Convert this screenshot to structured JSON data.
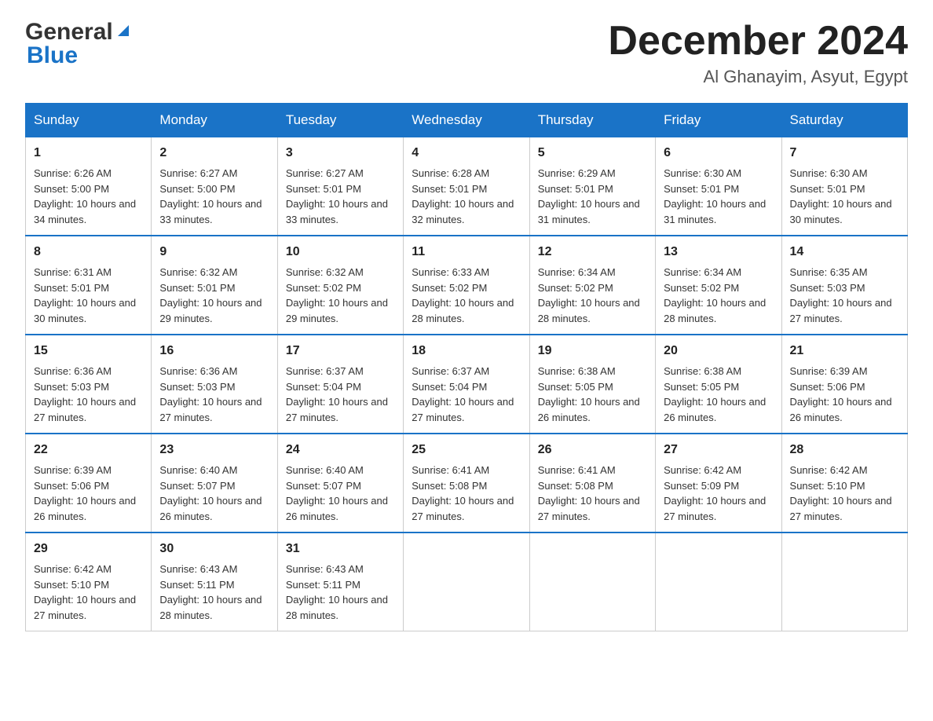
{
  "header": {
    "logo_general": "General",
    "logo_blue": "Blue",
    "month_title": "December 2024",
    "subtitle": "Al Ghanayim, Asyut, Egypt"
  },
  "days_of_week": [
    "Sunday",
    "Monday",
    "Tuesday",
    "Wednesday",
    "Thursday",
    "Friday",
    "Saturday"
  ],
  "weeks": [
    [
      {
        "day": "1",
        "sunrise": "6:26 AM",
        "sunset": "5:00 PM",
        "daylight": "10 hours and 34 minutes."
      },
      {
        "day": "2",
        "sunrise": "6:27 AM",
        "sunset": "5:00 PM",
        "daylight": "10 hours and 33 minutes."
      },
      {
        "day": "3",
        "sunrise": "6:27 AM",
        "sunset": "5:01 PM",
        "daylight": "10 hours and 33 minutes."
      },
      {
        "day": "4",
        "sunrise": "6:28 AM",
        "sunset": "5:01 PM",
        "daylight": "10 hours and 32 minutes."
      },
      {
        "day": "5",
        "sunrise": "6:29 AM",
        "sunset": "5:01 PM",
        "daylight": "10 hours and 31 minutes."
      },
      {
        "day": "6",
        "sunrise": "6:30 AM",
        "sunset": "5:01 PM",
        "daylight": "10 hours and 31 minutes."
      },
      {
        "day": "7",
        "sunrise": "6:30 AM",
        "sunset": "5:01 PM",
        "daylight": "10 hours and 30 minutes."
      }
    ],
    [
      {
        "day": "8",
        "sunrise": "6:31 AM",
        "sunset": "5:01 PM",
        "daylight": "10 hours and 30 minutes."
      },
      {
        "day": "9",
        "sunrise": "6:32 AM",
        "sunset": "5:01 PM",
        "daylight": "10 hours and 29 minutes."
      },
      {
        "day": "10",
        "sunrise": "6:32 AM",
        "sunset": "5:02 PM",
        "daylight": "10 hours and 29 minutes."
      },
      {
        "day": "11",
        "sunrise": "6:33 AM",
        "sunset": "5:02 PM",
        "daylight": "10 hours and 28 minutes."
      },
      {
        "day": "12",
        "sunrise": "6:34 AM",
        "sunset": "5:02 PM",
        "daylight": "10 hours and 28 minutes."
      },
      {
        "day": "13",
        "sunrise": "6:34 AM",
        "sunset": "5:02 PM",
        "daylight": "10 hours and 28 minutes."
      },
      {
        "day": "14",
        "sunrise": "6:35 AM",
        "sunset": "5:03 PM",
        "daylight": "10 hours and 27 minutes."
      }
    ],
    [
      {
        "day": "15",
        "sunrise": "6:36 AM",
        "sunset": "5:03 PM",
        "daylight": "10 hours and 27 minutes."
      },
      {
        "day": "16",
        "sunrise": "6:36 AM",
        "sunset": "5:03 PM",
        "daylight": "10 hours and 27 minutes."
      },
      {
        "day": "17",
        "sunrise": "6:37 AM",
        "sunset": "5:04 PM",
        "daylight": "10 hours and 27 minutes."
      },
      {
        "day": "18",
        "sunrise": "6:37 AM",
        "sunset": "5:04 PM",
        "daylight": "10 hours and 27 minutes."
      },
      {
        "day": "19",
        "sunrise": "6:38 AM",
        "sunset": "5:05 PM",
        "daylight": "10 hours and 26 minutes."
      },
      {
        "day": "20",
        "sunrise": "6:38 AM",
        "sunset": "5:05 PM",
        "daylight": "10 hours and 26 minutes."
      },
      {
        "day": "21",
        "sunrise": "6:39 AM",
        "sunset": "5:06 PM",
        "daylight": "10 hours and 26 minutes."
      }
    ],
    [
      {
        "day": "22",
        "sunrise": "6:39 AM",
        "sunset": "5:06 PM",
        "daylight": "10 hours and 26 minutes."
      },
      {
        "day": "23",
        "sunrise": "6:40 AM",
        "sunset": "5:07 PM",
        "daylight": "10 hours and 26 minutes."
      },
      {
        "day": "24",
        "sunrise": "6:40 AM",
        "sunset": "5:07 PM",
        "daylight": "10 hours and 26 minutes."
      },
      {
        "day": "25",
        "sunrise": "6:41 AM",
        "sunset": "5:08 PM",
        "daylight": "10 hours and 27 minutes."
      },
      {
        "day": "26",
        "sunrise": "6:41 AM",
        "sunset": "5:08 PM",
        "daylight": "10 hours and 27 minutes."
      },
      {
        "day": "27",
        "sunrise": "6:42 AM",
        "sunset": "5:09 PM",
        "daylight": "10 hours and 27 minutes."
      },
      {
        "day": "28",
        "sunrise": "6:42 AM",
        "sunset": "5:10 PM",
        "daylight": "10 hours and 27 minutes."
      }
    ],
    [
      {
        "day": "29",
        "sunrise": "6:42 AM",
        "sunset": "5:10 PM",
        "daylight": "10 hours and 27 minutes."
      },
      {
        "day": "30",
        "sunrise": "6:43 AM",
        "sunset": "5:11 PM",
        "daylight": "10 hours and 28 minutes."
      },
      {
        "day": "31",
        "sunrise": "6:43 AM",
        "sunset": "5:11 PM",
        "daylight": "10 hours and 28 minutes."
      },
      null,
      null,
      null,
      null
    ]
  ]
}
